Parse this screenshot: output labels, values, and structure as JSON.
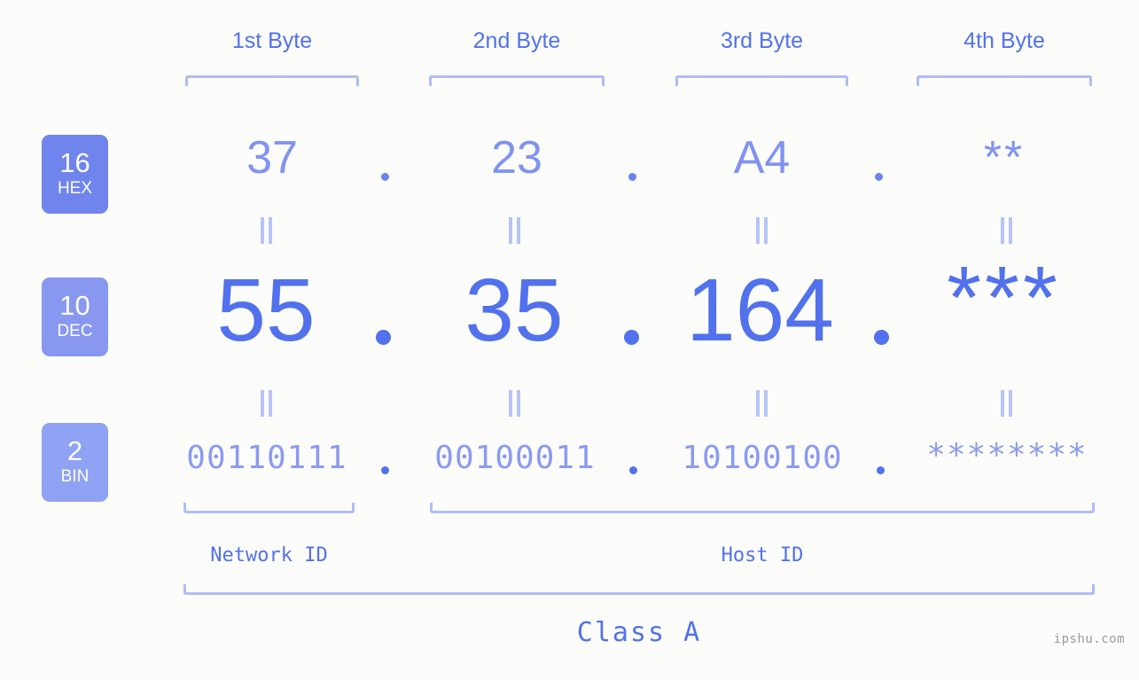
{
  "background_color": "#fcfdfa",
  "accent_color": "#5271ed",
  "bracket_color": "#b0bcf7",
  "byte_headers": [
    {
      "label": "1st Byte"
    },
    {
      "label": "2nd Byte"
    },
    {
      "label": "3rd Byte"
    },
    {
      "label": "4th Byte"
    }
  ],
  "bases": [
    {
      "number": "16",
      "name": "HEX",
      "color": "#7084ee"
    },
    {
      "number": "10",
      "name": "DEC",
      "color": "#8898f1"
    },
    {
      "number": "2",
      "name": "BIN",
      "color": "#8fa2f4"
    }
  ],
  "rows": {
    "hex": {
      "values": [
        "37",
        "23",
        "A4",
        "**"
      ],
      "separator": "."
    },
    "dec": {
      "values": [
        "55",
        "35",
        "164",
        "***"
      ],
      "separator": "."
    },
    "bin": {
      "values": [
        "00110111",
        "00100011",
        "10100100",
        "********"
      ],
      "separator": "."
    }
  },
  "equals_symbol": "=",
  "footer": {
    "network_id_label": "Network ID",
    "host_id_label": "Host ID",
    "class_label": "Class A"
  },
  "watermark": "ipshu.com"
}
